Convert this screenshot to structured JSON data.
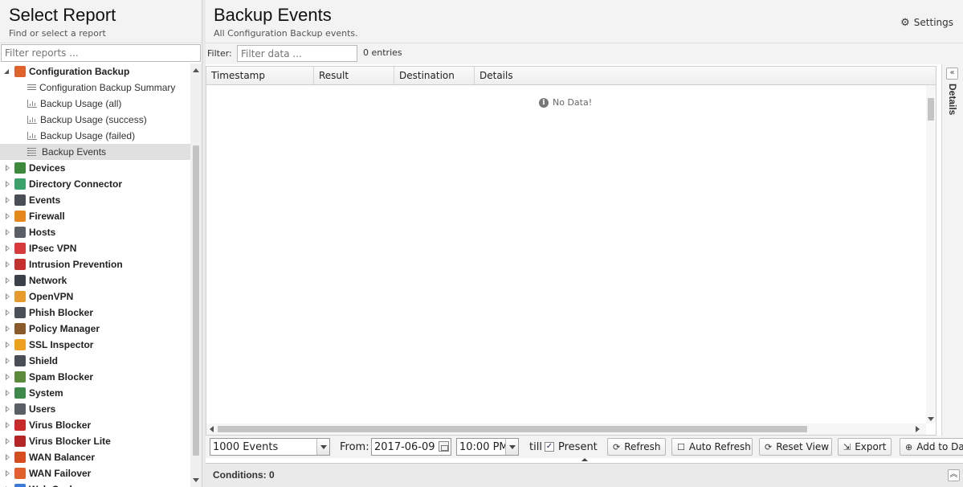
{
  "left_panel": {
    "title": "Select Report",
    "subtitle": "Find or select a report",
    "filter_placeholder": "Filter reports ..."
  },
  "tree": {
    "expanded": {
      "label": "Configuration Backup",
      "icon": "configuration-backup-icon",
      "color": "#e0612a"
    },
    "children": [
      {
        "label": "Configuration Backup Summary",
        "icon": "text-lines-icon"
      },
      {
        "label": "Backup Usage (all)",
        "icon": "bar-chart-icon"
      },
      {
        "label": "Backup Usage (success)",
        "icon": "bar-chart-icon"
      },
      {
        "label": "Backup Usage (failed)",
        "icon": "bar-chart-icon"
      },
      {
        "label": "Backup Events",
        "icon": "event-list-icon",
        "selected": true
      }
    ],
    "apps": [
      {
        "label": "Devices",
        "icon": "devices-icon",
        "color": "#3d8a3d"
      },
      {
        "label": "Directory Connector",
        "icon": "directory-connector-icon",
        "color": "#3aa36b"
      },
      {
        "label": "Events",
        "icon": "events-icon",
        "color": "#4a4f57"
      },
      {
        "label": "Firewall",
        "icon": "firewall-icon",
        "color": "#e8871d"
      },
      {
        "label": "Hosts",
        "icon": "hosts-icon",
        "color": "#5a5f66"
      },
      {
        "label": "IPsec VPN",
        "icon": "ipsec-vpn-icon",
        "color": "#d63a3a"
      },
      {
        "label": "Intrusion Prevention",
        "icon": "intrusion-prevention-icon",
        "color": "#c8302f"
      },
      {
        "label": "Network",
        "icon": "network-icon",
        "color": "#3c4149"
      },
      {
        "label": "OpenVPN",
        "icon": "openvpn-icon",
        "color": "#e79b2b"
      },
      {
        "label": "Phish Blocker",
        "icon": "phish-blocker-icon",
        "color": "#4b5058"
      },
      {
        "label": "Policy Manager",
        "icon": "policy-manager-icon",
        "color": "#8a5a2b"
      },
      {
        "label": "SSL Inspector",
        "icon": "ssl-inspector-icon",
        "color": "#f0a020"
      },
      {
        "label": "Shield",
        "icon": "shield-icon",
        "color": "#4a4f57"
      },
      {
        "label": "Spam Blocker",
        "icon": "spam-blocker-icon",
        "color": "#5b8a3a"
      },
      {
        "label": "System",
        "icon": "system-icon",
        "color": "#3d8a4a"
      },
      {
        "label": "Users",
        "icon": "users-icon",
        "color": "#5a5f66"
      },
      {
        "label": "Virus Blocker",
        "icon": "virus-blocker-icon",
        "color": "#c82a2a"
      },
      {
        "label": "Virus Blocker Lite",
        "icon": "virus-blocker-lite-icon",
        "color": "#b32626"
      },
      {
        "label": "WAN Balancer",
        "icon": "wan-balancer-icon",
        "color": "#d94a1f"
      },
      {
        "label": "WAN Failover",
        "icon": "wan-failover-icon",
        "color": "#e0612a"
      },
      {
        "label": "Web Cache",
        "icon": "web-cache-icon",
        "color": "#3a7bd5"
      }
    ]
  },
  "main": {
    "title": "Backup Events",
    "subtitle": "All Configuration Backup events.",
    "settings_label": "Settings",
    "filter_label": "Filter:",
    "filter_placeholder": "Filter data ...",
    "entries_text": "0 entries",
    "columns": [
      "Timestamp",
      "Result",
      "Destination",
      "Details"
    ],
    "no_data_text": "No Data!",
    "details_label": "Details"
  },
  "toolbar": {
    "limit_value": "1000 Events",
    "from_label": "From:",
    "from_date": "2017-06-09",
    "from_time": "10:00 PM",
    "till_label": "till",
    "present_label": "Present",
    "present_checked": "✓",
    "refresh_label": "Refresh",
    "auto_refresh_label": "Auto Refresh",
    "reset_view_label": "Reset View",
    "export_label": "Export",
    "add_dashboard_label": "Add to Da"
  },
  "conditions": {
    "label": "Conditions: 0"
  }
}
